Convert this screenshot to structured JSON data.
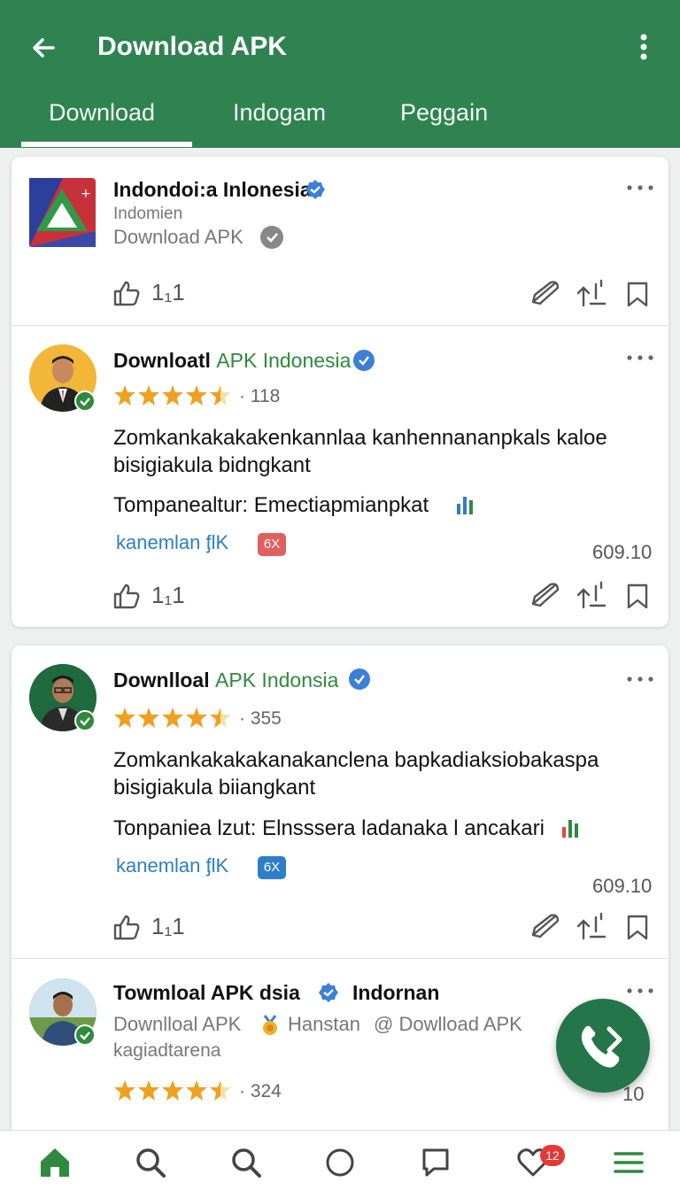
{
  "header": {
    "title": "Download APK",
    "tabs": [
      {
        "label": "Download",
        "active": true
      },
      {
        "label": "Indogam",
        "active": false
      },
      {
        "label": "Peggain",
        "active": false
      }
    ]
  },
  "cards": [
    {
      "name": "Indondoi:a Inlonesia",
      "subtitle": "Indomien",
      "subtitle2": "Download APK",
      "likes": "1₁1"
    },
    {
      "name_bold": "Downloatl",
      "name_green": "APK Indonesia",
      "rating": 4.5,
      "rating_count": "· 118",
      "body_line1": "Zomkankakakakenkannlaa kanhennananpkals kaloe",
      "body_line2": "bisigiakula bidngkant",
      "body_line3": "Tompanealtur: Emectiapmianpkat",
      "link": "kanemlan ᶂlK",
      "badge": "6X",
      "stat": "609.10",
      "likes": "1₁1"
    },
    {
      "name_bold": "Downlloal",
      "name_green": "APK Indonsia",
      "rating": 4.5,
      "rating_count": "· 355",
      "body_line1": "Zomkankakakakanakanclena bapkadiaksiobakaspa",
      "body_line2": "bisigiakula biiangkant",
      "body_line3": "Tonpaniea lzut: Elnsssera ladanaka l ancakari",
      "link": "kanemlan ᶂlK",
      "badge": "6X",
      "stat": "609.10",
      "likes": "1₁1"
    },
    {
      "name_bold": "Towmloal APK dsia",
      "name_suffix": "Indornan",
      "subtitle_a": "Downlloal APK",
      "subtitle_b": "Hanstan",
      "subtitle_c": "@ Dowlload APK",
      "subtitle2": "kagiadtarena",
      "rating": 4.5,
      "rating_count": "· 324",
      "stat": "10"
    }
  ],
  "bottom_nav": {
    "badge_count": "12",
    "items": [
      "home-icon",
      "search-icon",
      "search-icon",
      "circle-icon",
      "chat-icon",
      "heart-icon",
      "menu-icon"
    ]
  },
  "colors": {
    "primary": "#2f8350",
    "accent_green": "#2f8a3e",
    "link_blue": "#2e7ec8",
    "star": "#f0a020",
    "verified_blue": "#3b7fd8",
    "badge_red": "#e53935"
  }
}
